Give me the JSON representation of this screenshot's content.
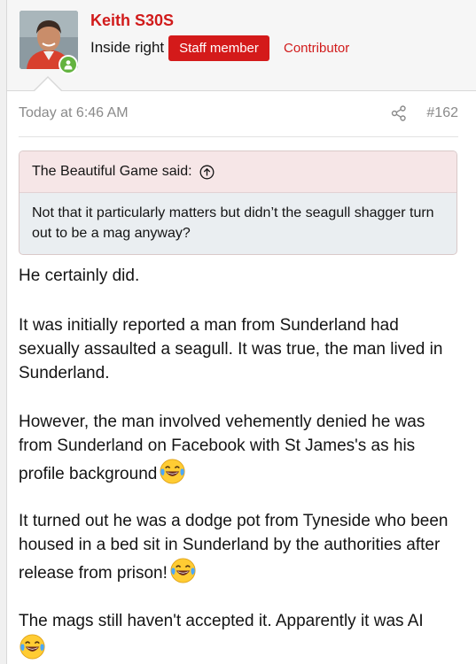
{
  "user": {
    "name": "Keith S30S",
    "title": "Inside right",
    "badge": "Staff member",
    "role": "Contributor",
    "online": true
  },
  "post": {
    "timestamp": "Today at 6:46 AM",
    "number": "#162"
  },
  "quote": {
    "author_line": "The Beautiful Game said:",
    "text": "Not that it particularly matters but didn’t the seagull shagger turn out to be a mag anyway?"
  },
  "message": {
    "p1": "He certainly did.",
    "p2": "It was initially reported a man from Sunderland had sexually assaulted a seagull. It was true, the man lived in Sunderland.",
    "p3": "However, the man involved vehemently denied he was from Sunderland on Facebook with St James's as his profile background",
    "p4": "It turned out he was a dodge pot from Tyneside who been housed in a bed sit in Sunderland by the authorities after release from prison!",
    "p5": "The mags still haven't accepted it. Apparently it was AI"
  },
  "icons": {
    "emoji": "laughing-tears-emoji",
    "share": "share-icon",
    "quote_jump": "arrow-up-circle-icon",
    "online": "online-user-icon"
  },
  "colors": {
    "accent": "#d11b1b",
    "badge_bg": "#d41a1a",
    "online": "#63b33f",
    "quote_head_bg": "#f6e6e7",
    "quote_body_bg": "#eaeef1"
  }
}
